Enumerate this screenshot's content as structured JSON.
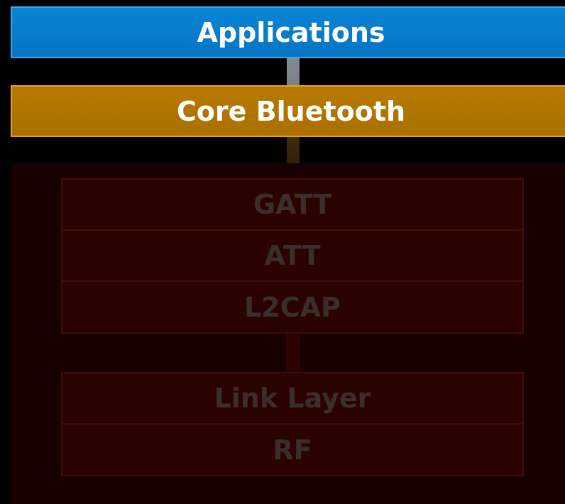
{
  "layers": {
    "applications": "Applications",
    "core_bluetooth": "Core Bluetooth",
    "host_stack": [
      "GATT",
      "ATT",
      "L2CAP"
    ],
    "controller_stack": [
      "Link Layer",
      "RF"
    ]
  },
  "colors": {
    "applications": "#0574c4",
    "core_bluetooth": "#b87a00",
    "controller_background": "#180000",
    "stack_box": "#2a0301",
    "stack_text": "#3a2e2d"
  }
}
